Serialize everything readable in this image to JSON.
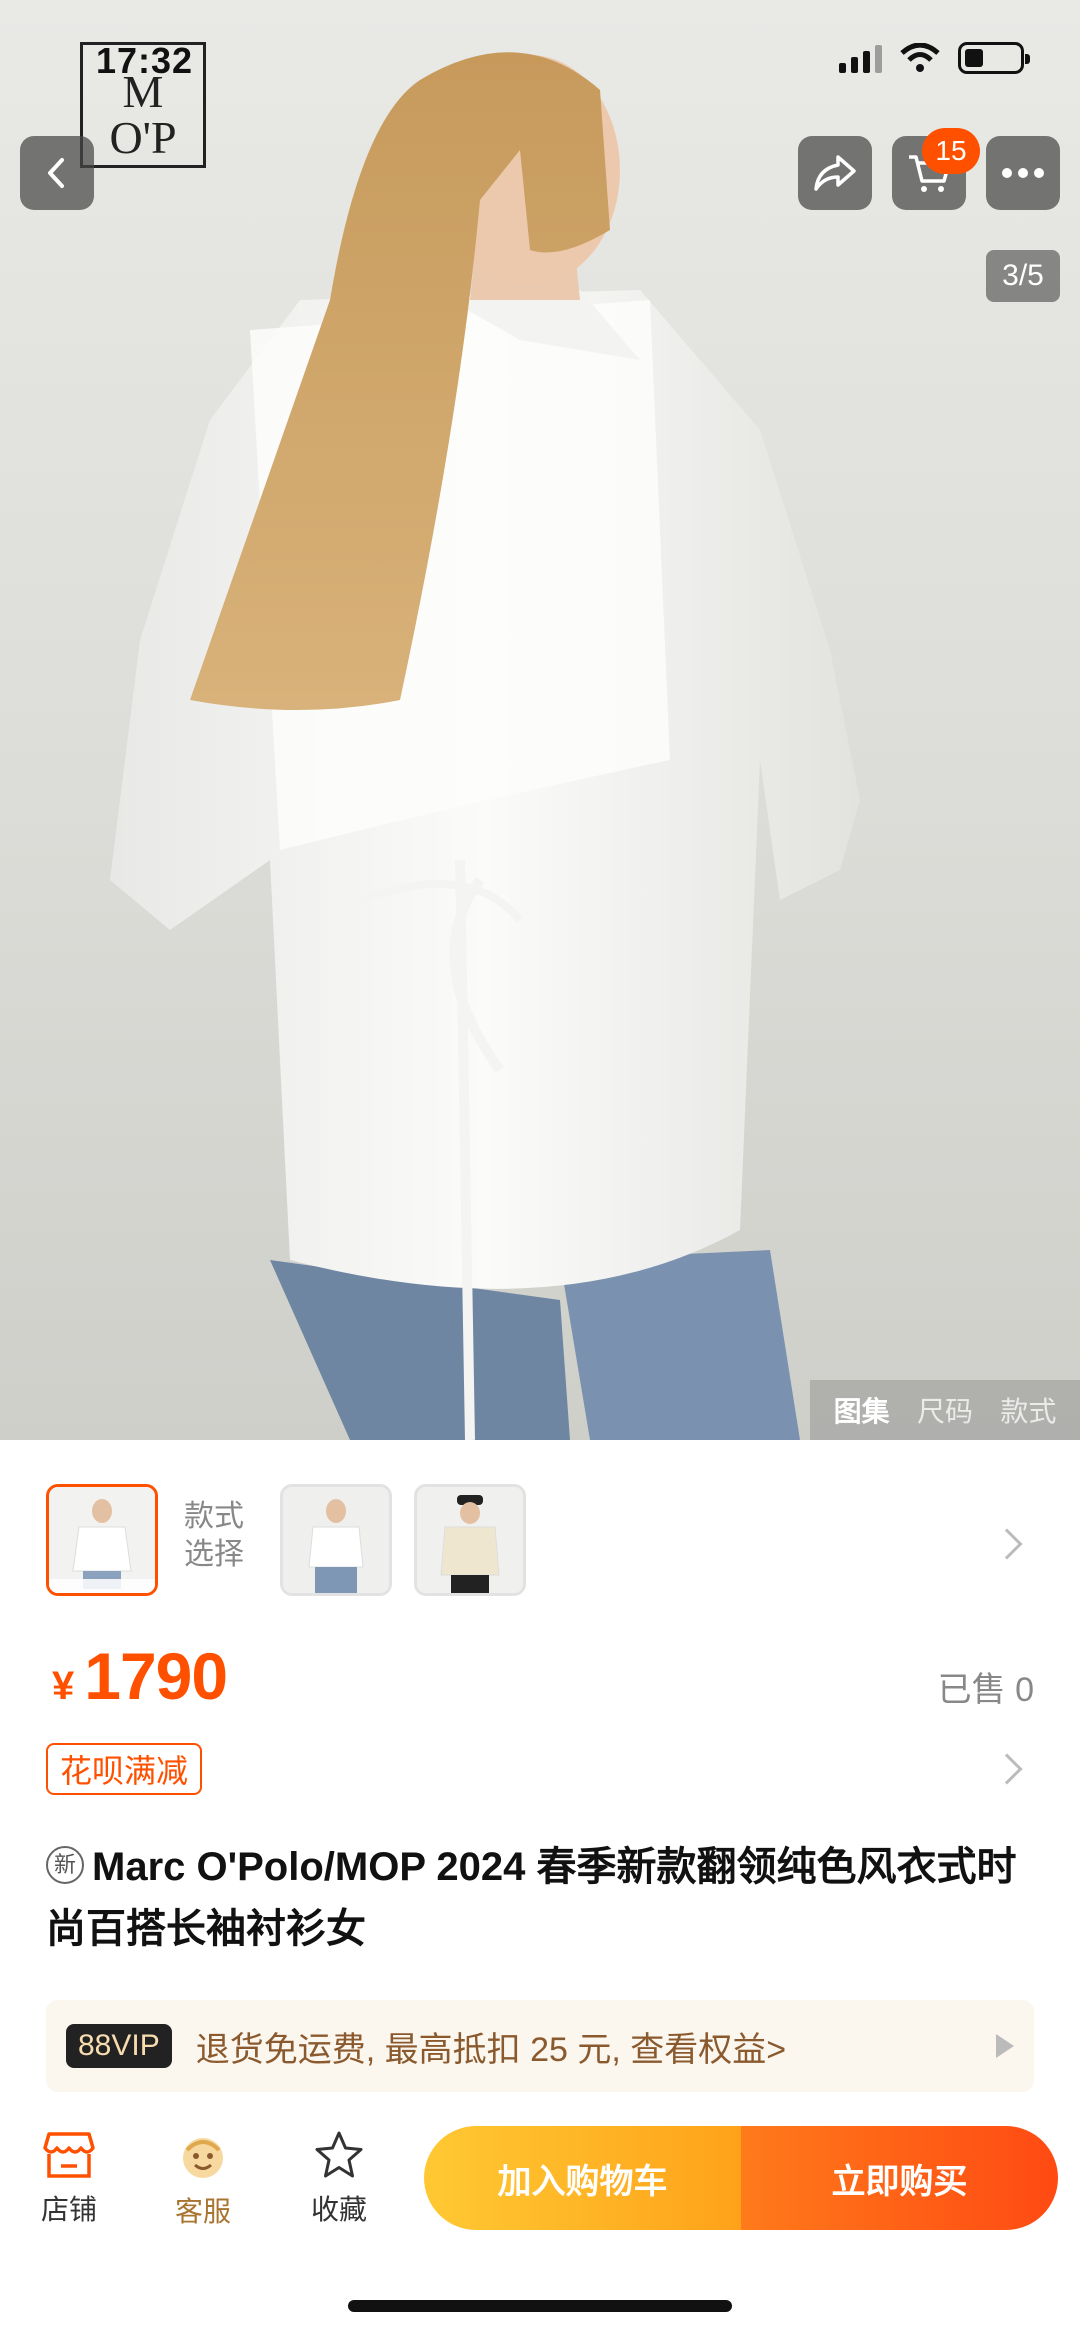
{
  "status_bar": {
    "time": "17:32"
  },
  "brand_logo": {
    "line1": "M",
    "line2": "O'P"
  },
  "header": {
    "cart_count": "15",
    "image_counter": "3/5"
  },
  "image_tabs": [
    {
      "label": "图集",
      "active": true
    },
    {
      "label": "尺码",
      "active": false
    },
    {
      "label": "款式",
      "active": false
    }
  ],
  "sku": {
    "label": "款式选择"
  },
  "price": {
    "currency": "¥",
    "value": "1790"
  },
  "sold": "已售 0",
  "promo_tag": "花呗满减",
  "product": {
    "new_badge": "新",
    "title": "Marc O'Polo/MOP 2024 春季新款翻领纯色风衣式时尚百搭长袖衬衫女"
  },
  "vip": {
    "badge": "88VIP",
    "text": "退货免运费, 最高抵扣 25 元, 查看权益>"
  },
  "bottom_bar": {
    "shop_label": "店铺",
    "service_label": "客服",
    "favorite_label": "收藏",
    "add_to_cart": "加入购物车",
    "buy_now": "立即购买"
  },
  "colors": {
    "accent": "#ff5000",
    "cart_btn": "#ffb21f",
    "buy_btn": "#ff5a13",
    "vip_text": "#8a5a2e"
  }
}
